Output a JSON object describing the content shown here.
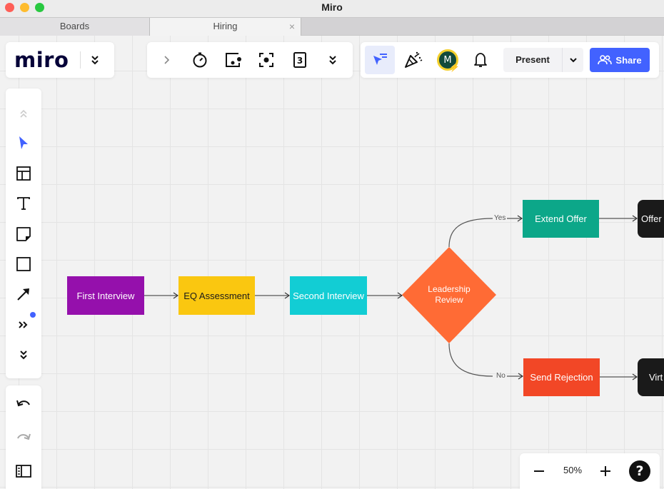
{
  "window": {
    "title": "Miro"
  },
  "tabs": [
    {
      "label": "Boards",
      "active": false
    },
    {
      "label": "Hiring",
      "active": true,
      "close": "×"
    }
  ],
  "logo": {
    "text": "miro",
    "menu_icon": "double-chevron-down-icon"
  },
  "top_tools": [
    {
      "name": "expand-icon",
      "label": "Expand"
    },
    {
      "name": "timer-icon",
      "label": "Timer"
    },
    {
      "name": "card-icon",
      "label": "Card"
    },
    {
      "name": "focus-icon",
      "label": "Focus"
    },
    {
      "name": "countdown-icon",
      "label": "3"
    },
    {
      "name": "more-icon",
      "label": "More"
    }
  ],
  "collab": {
    "select_tool": "pointer-filter-icon",
    "celebrate": "party-popper-icon",
    "avatar_initial": "M",
    "notifications": "bell-icon",
    "present_label": "Present",
    "share_label": "Share"
  },
  "left_toolbar": [
    {
      "name": "collapse-icon"
    },
    {
      "name": "select-icon",
      "active": true
    },
    {
      "name": "templates-icon"
    },
    {
      "name": "text-icon"
    },
    {
      "name": "sticky-note-icon"
    },
    {
      "name": "shape-icon"
    },
    {
      "name": "connector-icon"
    },
    {
      "name": "more-apps-icon",
      "badge": true
    },
    {
      "name": "expand-toolbar-icon"
    }
  ],
  "history": {
    "undo": "undo-icon",
    "redo": "redo-icon",
    "board_panel": "panel-icon"
  },
  "zoom": {
    "value": "50%",
    "help": "?"
  },
  "flowchart": {
    "nodes": {
      "first": "First Interview",
      "eq": "EQ Assessment",
      "second": "Second Interview",
      "review": "Leadership Review",
      "review_line1": "Leadership",
      "review_line2": "Review",
      "extend": "Extend Offer",
      "reject": "Send Rejection",
      "offer": "Offer ...",
      "virt": "Virt"
    },
    "edges": {
      "yes": "Yes",
      "no": "No"
    },
    "colors": {
      "first": "#9510ac",
      "eq": "#fac710",
      "second": "#12cdd4",
      "review": "#ff6b35",
      "extend": "#0ca789",
      "reject": "#f24726",
      "terminal": "#1a1a1a"
    }
  },
  "colors": {
    "accent": "#4262ff",
    "canvas": "#f2f2f2"
  }
}
